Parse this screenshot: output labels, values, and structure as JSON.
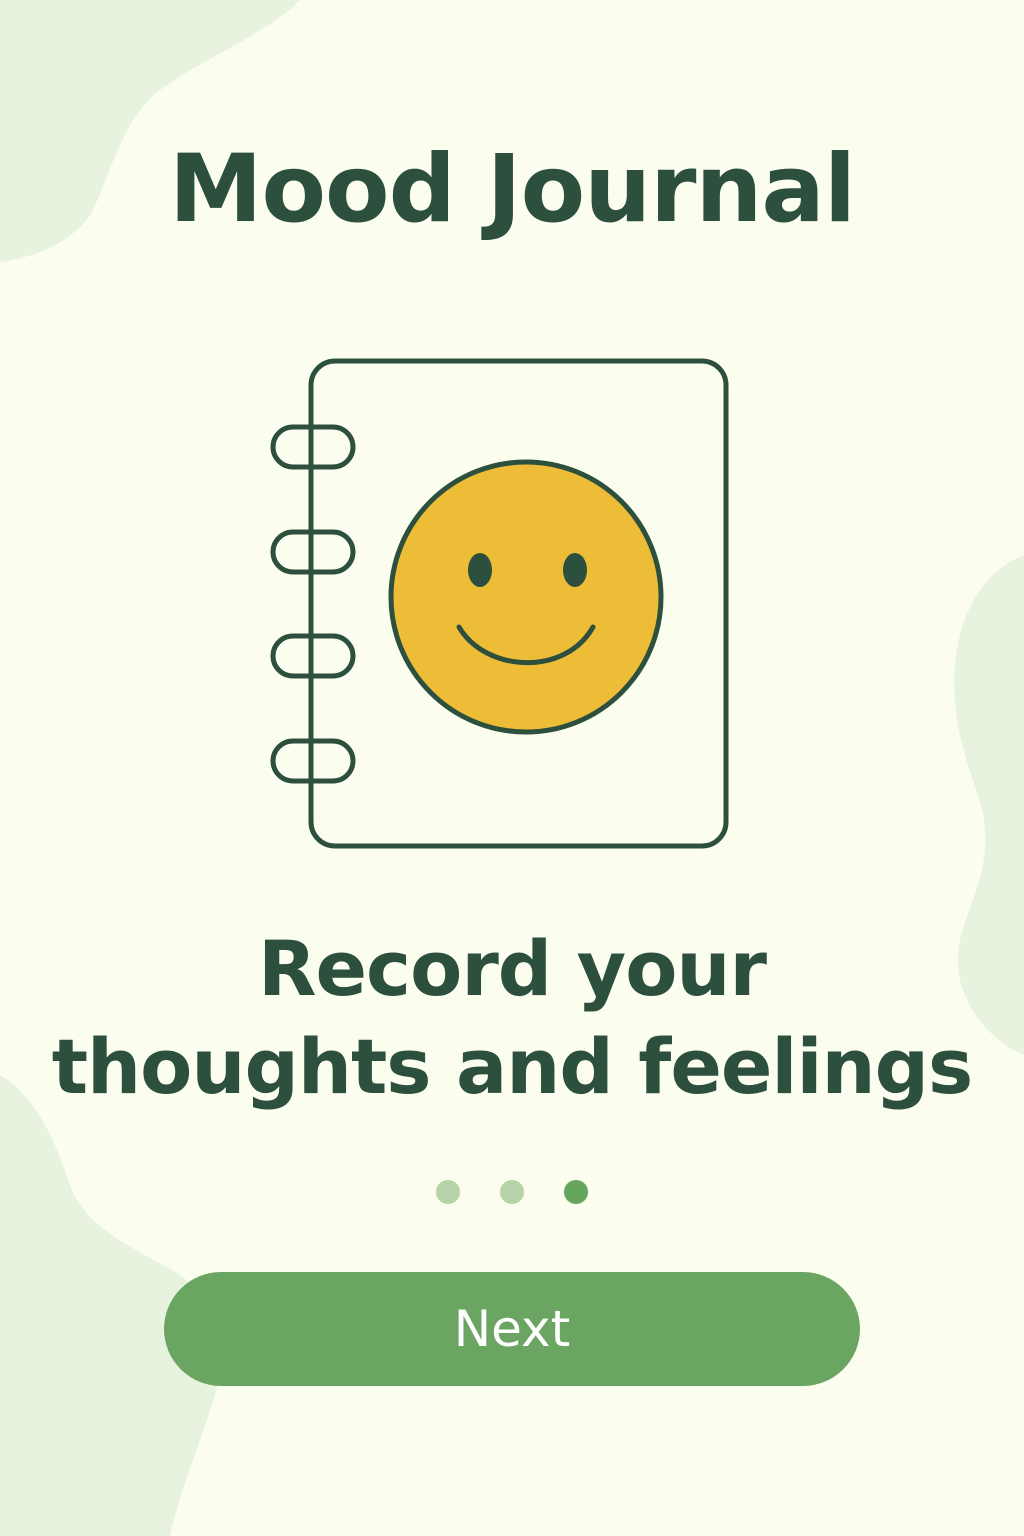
{
  "app": {
    "title": "Mood Journal"
  },
  "illustration": {
    "icon": "journal-smiley-icon"
  },
  "tagline": {
    "line1": "Record your",
    "line2": "thoughts and feelings"
  },
  "pagination": {
    "total": 3,
    "active_index": 2
  },
  "actions": {
    "next_label": "Next"
  },
  "colors": {
    "background": "#FBFDEE",
    "blob": "#E8F3DF",
    "text": "#2D4F3E",
    "accent": "#6AA662",
    "smiley": "#EEBD38",
    "dot_inactive": "#B6D3A9",
    "dot_active": "#66A45D"
  }
}
